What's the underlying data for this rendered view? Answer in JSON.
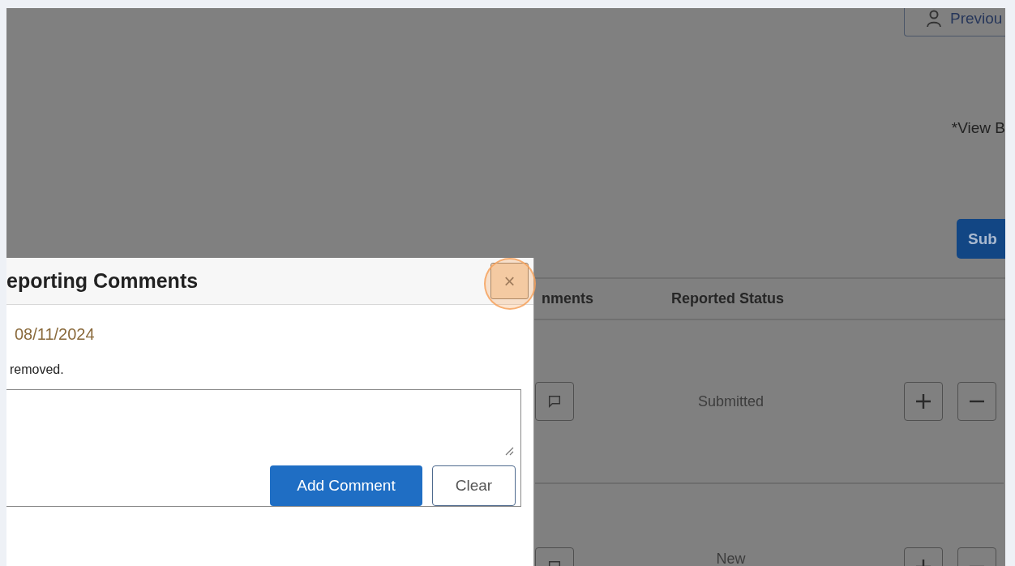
{
  "background": {
    "previous_button": "Previou",
    "view_note": "*View B",
    "submit_button": "Sub",
    "table": {
      "columns": [
        "nments",
        "Reported Status"
      ],
      "rows": [
        {
          "status": "Submitted"
        },
        {
          "status": "New"
        }
      ]
    }
  },
  "modal": {
    "title": "eporting Comments",
    "close": "×",
    "date": "08/11/2024",
    "message": "removed.",
    "buttons": [
      {
        "label": "Add Comment",
        "kind": "primary"
      },
      {
        "label": "Clear",
        "kind": "secondary"
      }
    ]
  }
}
